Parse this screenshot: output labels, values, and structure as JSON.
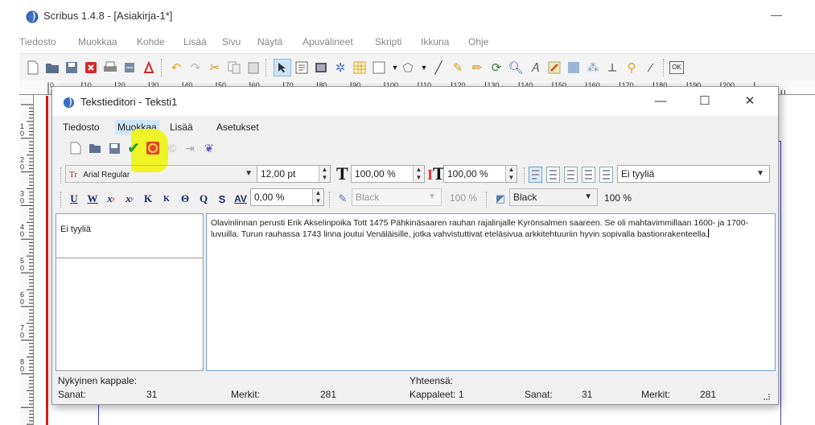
{
  "app": {
    "title": "Scribus 1.4.8 - [Asiakirja-1*]",
    "minimize_glyph": "—",
    "menu": [
      "Tiedosto",
      "Muokkaa",
      "Kohde",
      "Lisää",
      "Sivu",
      "Näytä",
      "Apuvälineet",
      "Skripti",
      "Ikkuna",
      "Ohje"
    ]
  },
  "ruler": {
    "h_ticks": [
      "0",
      "10",
      "20",
      "30",
      "40",
      "50",
      "60",
      "70",
      "80",
      "90",
      "100",
      "110",
      "120",
      "130",
      "140",
      "150",
      "160",
      "170",
      "180",
      "190",
      "200"
    ],
    "v_ticks": [
      "1",
      "2",
      "3",
      "4",
      "5",
      "6",
      "7",
      "8"
    ]
  },
  "editor": {
    "title": "Tekstieditori - Teksti1",
    "controls": {
      "minimize": "—",
      "maximize": "☐",
      "close": "✕"
    },
    "menu": [
      "Tiedosto",
      "Muokkaa",
      "Lisää",
      "Asetukset"
    ],
    "active_menu": "Muokkaa",
    "font": "Arial Regular",
    "font_icon": "Tr",
    "font_size": "12,00 pt",
    "scale_h": "100,00 %",
    "scale_v": "100,00 %",
    "paragraph_style": "Ei tyyliä",
    "tracking": "0,00 %",
    "stroke_color": "Black",
    "stroke_shade": "100 %",
    "fill_color": "Black",
    "fill_shade": "100 %",
    "style_list_item": "Ei tyyliä",
    "text": "Olavinlinnan perusti Erik Akselinpoika Tott 1475 Pähkinäsaaren rauhan rajalinjalle Kyrönsalmen saareen. Se oli mahtavimmillaan 1600- ja 1700-luvuilla. Turun rauhassa 1743 linna joutui Venäläisille, jotka vahvistuttivat eteläsivua arkkitehtuuriin hyvin sopivalla bastionrakenteella.",
    "status": {
      "current_paragraph_label": "Nykyinen kappale:",
      "words_label": "Sanat:",
      "words": "31",
      "chars_label": "Merkit:",
      "chars": "281",
      "total_label": "Yhteensä:",
      "paragraphs_label": "Kappaleet:",
      "paragraphs": "1",
      "total_words_label": "Sanat:",
      "total_words": "31",
      "total_chars_label": "Merkit:",
      "total_chars": "281"
    }
  },
  "colors": {
    "highlight": "#eef31a",
    "page_border": "#d21e1e",
    "margin_guide": "#3b46c9",
    "active_menu_bg": "#cde6f7",
    "text_area_border": "#6f9fd3"
  }
}
